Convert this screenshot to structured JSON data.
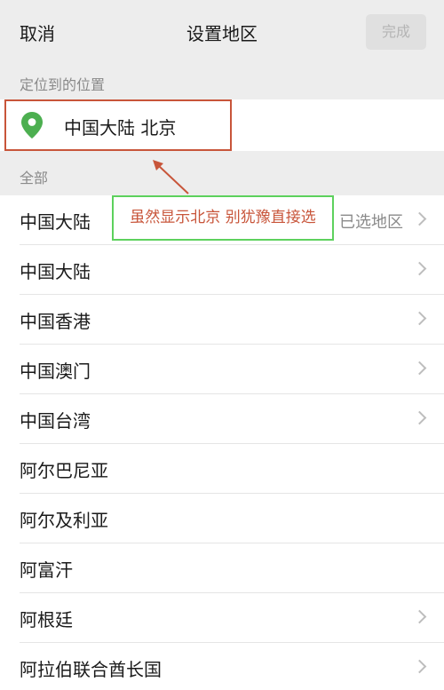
{
  "navbar": {
    "cancel_label": "取消",
    "title": "设置地区",
    "done_label": "完成"
  },
  "located": {
    "header": "定位到的位置",
    "location": "中国大陆 北京",
    "pin_color": "#4caf50"
  },
  "all": {
    "header": "全部",
    "items": [
      {
        "name": "中国大陆",
        "status": "已选地区",
        "has_chevron": true
      },
      {
        "name": "中国大陆",
        "status": "",
        "has_chevron": true
      },
      {
        "name": "中国香港",
        "status": "",
        "has_chevron": true
      },
      {
        "name": "中国澳门",
        "status": "",
        "has_chevron": true
      },
      {
        "name": "中国台湾",
        "status": "",
        "has_chevron": true
      },
      {
        "name": "阿尔巴尼亚",
        "status": "",
        "has_chevron": false
      },
      {
        "name": "阿尔及利亚",
        "status": "",
        "has_chevron": false
      },
      {
        "name": "阿富汗",
        "status": "",
        "has_chevron": false
      },
      {
        "name": "阿根廷",
        "status": "",
        "has_chevron": true
      },
      {
        "name": "阿拉伯联合酋长国",
        "status": "",
        "has_chevron": true
      }
    ]
  },
  "annotation": {
    "note": "虽然显示北京 别犹豫直接选",
    "highlight_color": "#c8553a",
    "note_border_color": "#5dd15d"
  }
}
